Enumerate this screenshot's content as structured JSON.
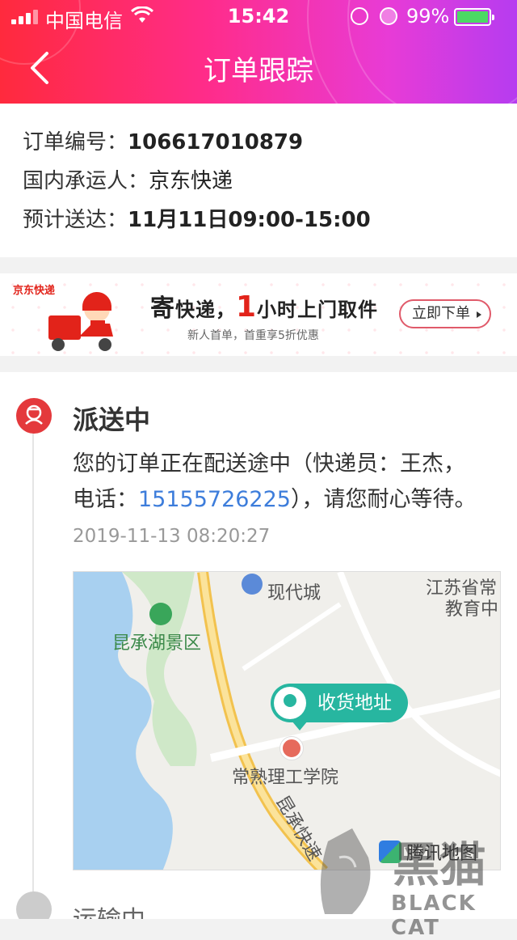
{
  "status_bar": {
    "carrier": "中国电信",
    "time": "15:42",
    "battery_percent": "99%"
  },
  "nav": {
    "title": "订单跟踪"
  },
  "order": {
    "number_label": "订单编号：",
    "number_value": "106617010879",
    "carrier_label": "国内承运人：",
    "carrier_value": "京东快递",
    "eta_label": "预计送达：",
    "eta_value": "11月11日09:00-15:00"
  },
  "banner": {
    "brand": "京东快递",
    "headline_1": "寄",
    "headline_2": "快递，",
    "headline_3": "1",
    "headline_4": "小时",
    "headline_5": "上门取件",
    "sub": "新人首单，首重享5折优惠",
    "cta": "立即下单"
  },
  "tracking": {
    "current_status": "派送中",
    "desc_1": "您的订单正在配送途中（快递员：王杰，电话：",
    "phone": "15155726225",
    "desc_2": "），请您耐心等待。",
    "time": "2019-11-13 08:20:27",
    "next_status": "运输中"
  },
  "map": {
    "label_scenic": "昆承湖景区",
    "label_city": "现代城",
    "label_edu_1": "江苏省常",
    "label_edu_2": "教育中",
    "pin_label": "收货地址",
    "label_school": "常熟理工学院",
    "label_road": "昆承快速",
    "provider": "腾讯地图"
  },
  "watermark": {
    "cn": "黑猫",
    "en": "BLACK CAT"
  },
  "colors": {
    "accent_red": "#e4393c",
    "phone_blue": "#3d7ddb",
    "pin_teal": "#27b6a0"
  }
}
